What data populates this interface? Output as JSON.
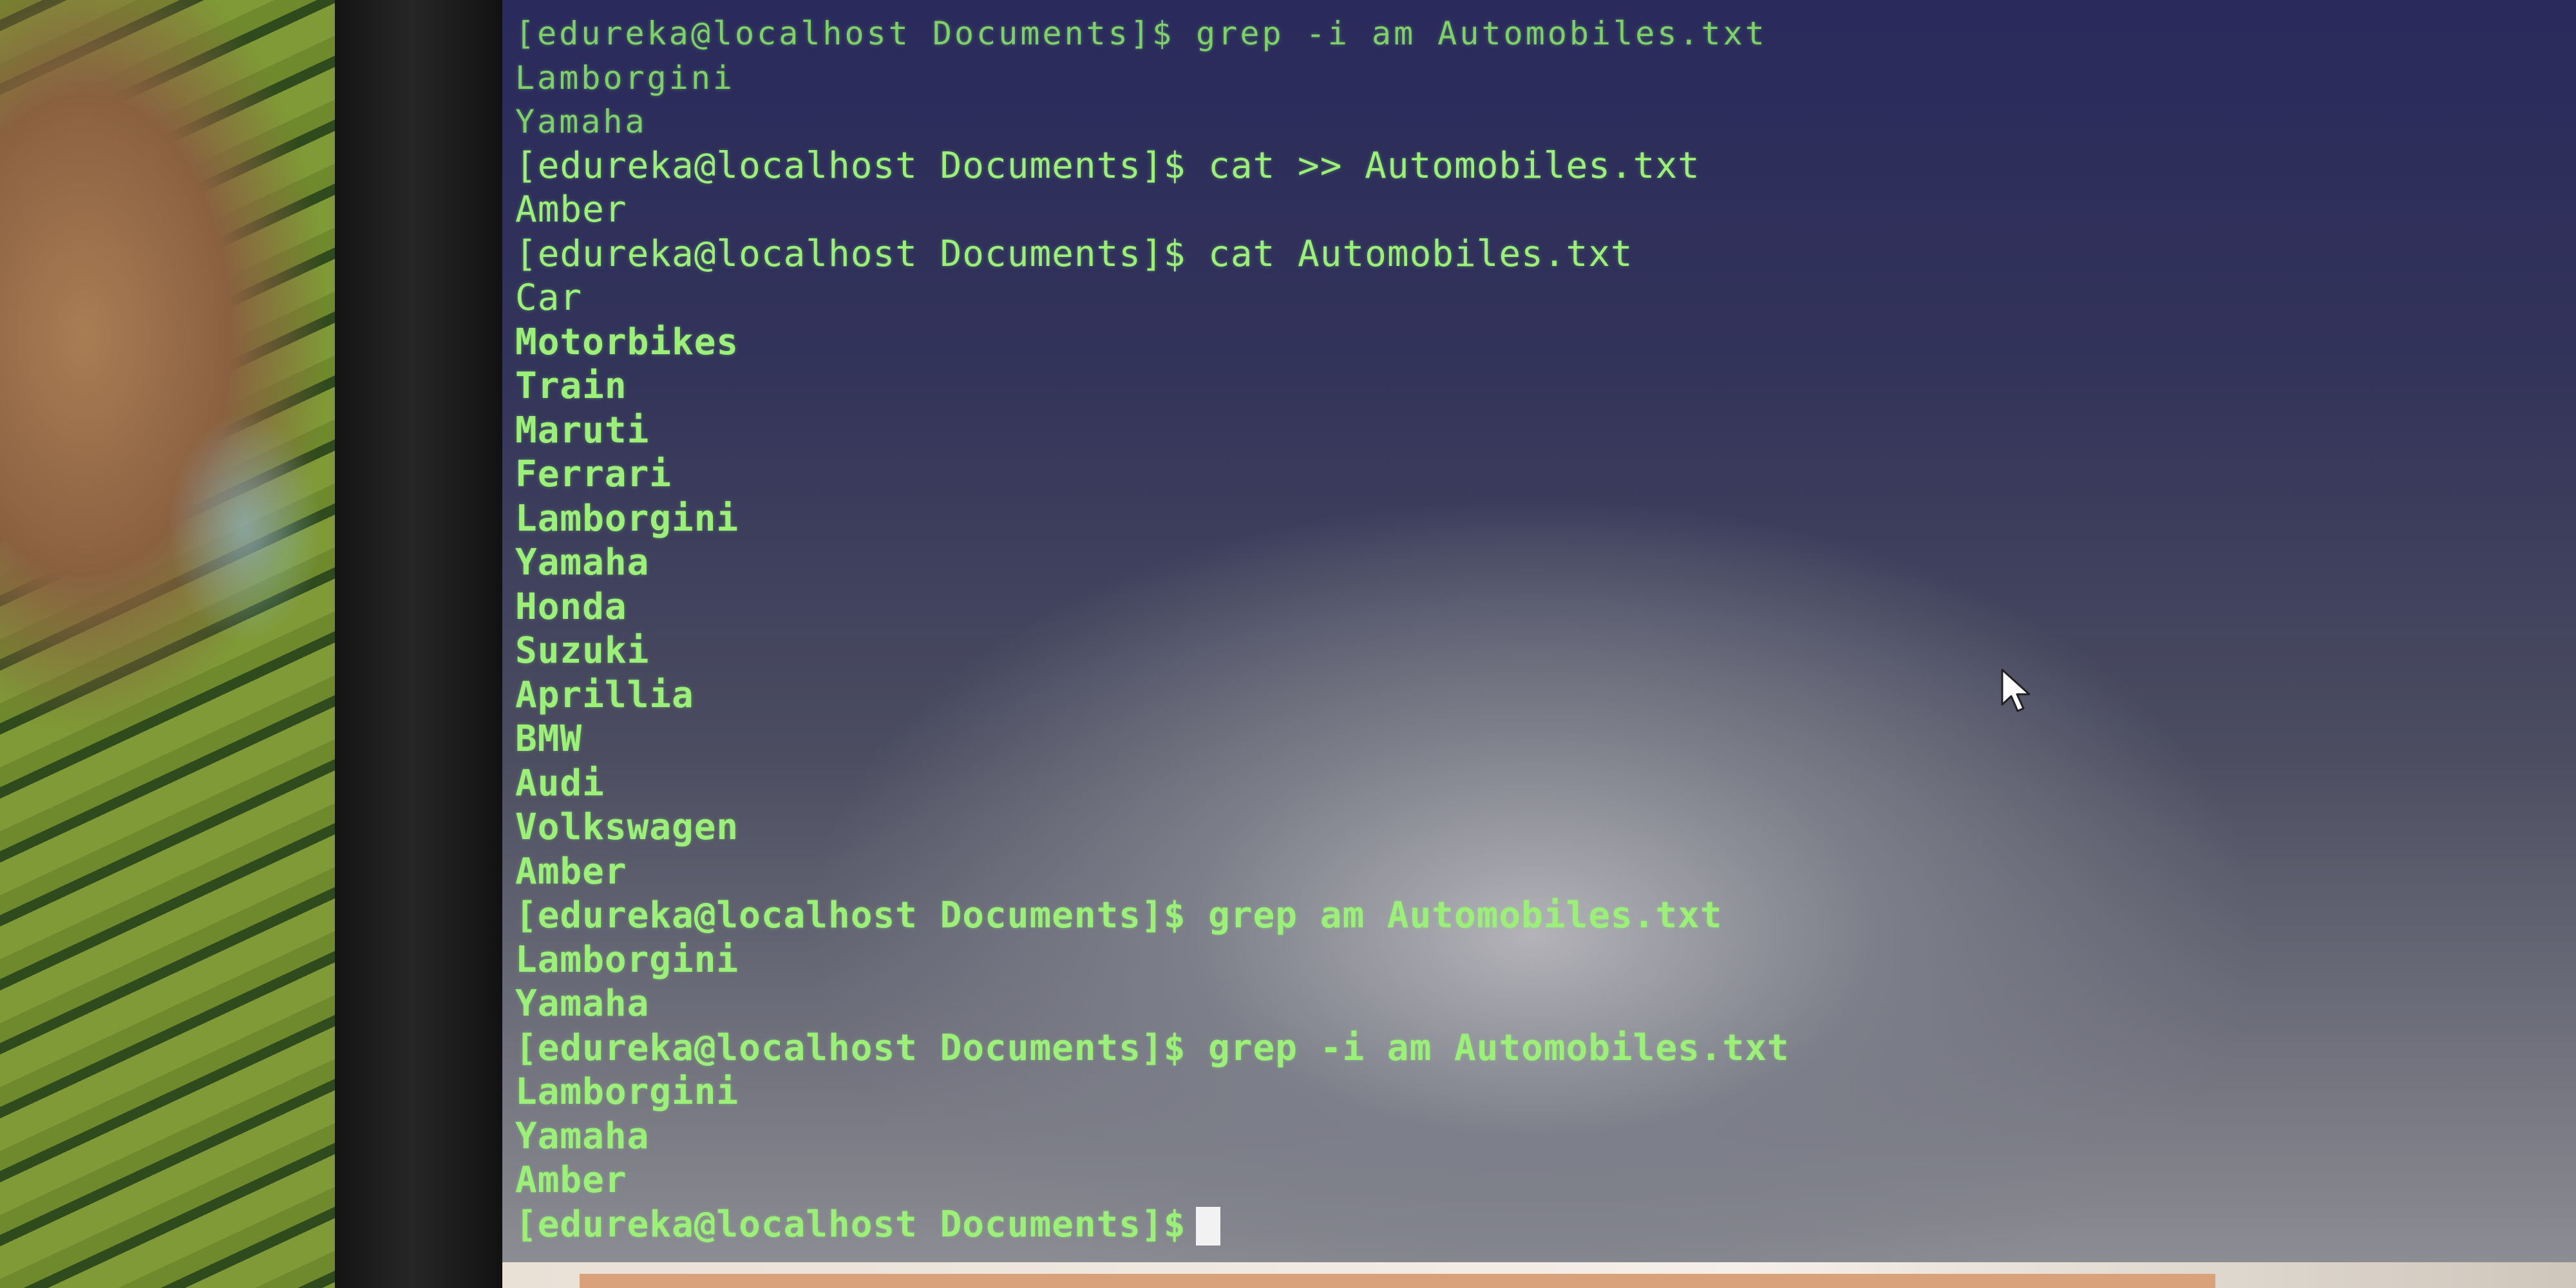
{
  "terminal": {
    "lines": [
      {
        "text": "[edureka@localhost Documents]$ grep -i am Automobiles.txt",
        "style": "faint"
      },
      {
        "text": "Lamborgini",
        "style": "faint"
      },
      {
        "text": "Yamaha",
        "style": "faint"
      },
      {
        "text": "[edureka@localhost Documents]$ cat >> Automobiles.txt",
        "style": "normal"
      },
      {
        "text": "Amber",
        "style": "normal"
      },
      {
        "text": "[edureka@localhost Documents]$ cat Automobiles.txt",
        "style": "normal"
      },
      {
        "text": "Car",
        "style": "normal"
      },
      {
        "text": "Motorbikes",
        "style": "bold"
      },
      {
        "text": "Train",
        "style": "bold"
      },
      {
        "text": "Maruti",
        "style": "bold"
      },
      {
        "text": "Ferrari",
        "style": "bold"
      },
      {
        "text": "Lamborgini",
        "style": "bold"
      },
      {
        "text": "Yamaha",
        "style": "bold"
      },
      {
        "text": "Honda",
        "style": "bold"
      },
      {
        "text": "Suzuki",
        "style": "bold"
      },
      {
        "text": "Aprillia",
        "style": "bold"
      },
      {
        "text": "BMW",
        "style": "bold"
      },
      {
        "text": "Audi",
        "style": "bold"
      },
      {
        "text": "Volkswagen",
        "style": "bold"
      },
      {
        "text": "Amber",
        "style": "bold"
      },
      {
        "text": "[edureka@localhost Documents]$ grep am Automobiles.txt",
        "style": "bold"
      },
      {
        "text": "Lamborgini",
        "style": "bold"
      },
      {
        "text": "Yamaha",
        "style": "bold"
      },
      {
        "text": "[edureka@localhost Documents]$ grep -i am Automobiles.txt",
        "style": "bold"
      },
      {
        "text": "Lamborgini",
        "style": "bold"
      },
      {
        "text": "Yamaha",
        "style": "bold"
      },
      {
        "text": "Amber",
        "style": "bold"
      }
    ],
    "prompt": "[edureka@localhost Documents]$",
    "colors": {
      "text": "#9cf07a",
      "cursor": "#f2f2f2"
    }
  },
  "icons": {
    "pointer": "mouse-pointer-icon"
  }
}
